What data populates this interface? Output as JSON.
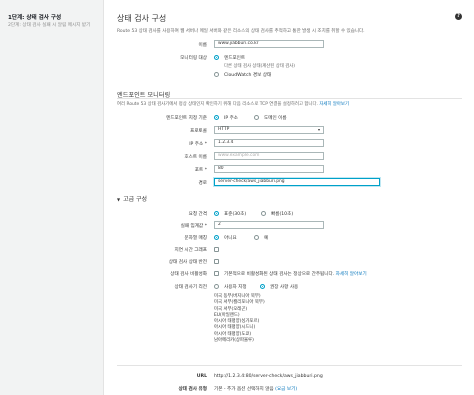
{
  "sidebar": {
    "step": "1단계: 상태 검사 구성",
    "step_desc": "2단계: 상태 검사 실패 시 알림 메시지 받기"
  },
  "main": {
    "title": "상태 검사 구성",
    "help_label": "?",
    "description": "Route 53 상태 검사를 사용하여 웹 서버나 메일 서버와 같은 리소스의 상태 검사를 추적하고 통한 발생 시 조치를 취할 수 있습니다.",
    "name_label": "이름",
    "name_value": "www.jiabburi.co.kr",
    "monitor_label": "모니터링 대상",
    "monitor_options": [
      {
        "label": "엔드포인트",
        "selected": true
      },
      {
        "label": "다른 상태 검사 상태(계산된 상태 검사)",
        "selected": false
      },
      {
        "label": "CloudWatch 경보 상태",
        "selected": false
      }
    ]
  },
  "endpoint": {
    "section_title": "엔드포인트 모니터링",
    "section_desc": "여러 Route 53 상태 검사기에서 정상 상태인지 확인하기 위해 다음 리소스로 TCP 연결을 설정하려고 합니다.",
    "section_link": "자세히 알아보기",
    "spec_label": "엔드포인트 지정 기준",
    "spec_options": [
      {
        "label": "IP 주소",
        "selected": true
      },
      {
        "label": "도메인 이름",
        "selected": false
      }
    ],
    "protocol_label": "프로토콜",
    "protocol_value": "HTTP",
    "ip_label": "IP 주소 *",
    "ip_value": "1.2.3.4",
    "host_label": "호스트 이름",
    "host_placeholder": "www.example.com",
    "port_label": "포트 *",
    "port_value": "80",
    "path_label": "경로",
    "path_value": "server-check/aws_jiabburi.png"
  },
  "advanced": {
    "title": "고급 구성",
    "interval_label": "요청 간격",
    "interval_options": [
      {
        "label": "표준(30초)",
        "selected": true
      },
      {
        "label": "빠름(10초)",
        "selected": false
      }
    ],
    "threshold_label": "실패 임계값 *",
    "threshold_value": "2",
    "string_match_label": "문자열 매칭",
    "string_match_options": [
      {
        "label": "아니요",
        "selected": true
      },
      {
        "label": "예",
        "selected": false
      }
    ],
    "latency_label": "지연 시간 그래프",
    "invert_label": "상태 검사 상태 반전",
    "sni_label": "상태 검사 비활성화",
    "sni_desc": "기본적으로 비활성화된 상태 검사는 정상으로 간주됩니다.",
    "sni_link": "자세히 알아보기",
    "regions_label": "상태 검사기 리전",
    "regions_options": [
      {
        "label": "사용자 지정",
        "selected": false
      },
      {
        "label": "권장 사항 사용",
        "selected": true
      }
    ],
    "regions_list": [
      "미국 동부(버지니아 북부)",
      "미국 서부(캘리포니아 북부)",
      "미국 서부(오레곤)",
      "EU(아일랜드)",
      "아시아 태평양(싱가포르)",
      "아시아 태평양(시드니)",
      "아시아 태평양(도쿄)",
      "남아메리카(상파울루)"
    ]
  },
  "footer": {
    "url_label": "URL",
    "url_value": "http://1.2.3.4:80/server-check/aws_jiabburi.png",
    "type_label": "상태 검사 유형",
    "type_value": "기본 - 추가 옵션 선택하지 않음",
    "type_link": "(요금 보기)"
  },
  "colors": {
    "accent": "#00a1c9",
    "link": "#0073bb",
    "sidebar_bg": "#f2f3f3"
  }
}
